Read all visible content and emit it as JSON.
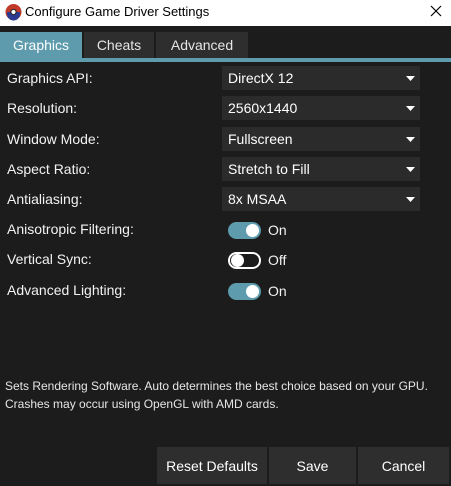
{
  "window": {
    "title": "Configure Game Driver Settings",
    "app_icon": "game-controller-icon",
    "close_icon": "close-icon"
  },
  "tabs": [
    {
      "label": "Graphics",
      "active": true
    },
    {
      "label": "Cheats",
      "active": false
    },
    {
      "label": "Advanced",
      "active": false
    }
  ],
  "settings": {
    "graphics_api": {
      "label": "Graphics API:",
      "value": "DirectX 12"
    },
    "resolution": {
      "label": "Resolution:",
      "value": "2560x1440"
    },
    "window_mode": {
      "label": "Window Mode:",
      "value": "Fullscreen"
    },
    "aspect_ratio": {
      "label": "Aspect Ratio:",
      "value": "Stretch to Fill"
    },
    "antialiasing": {
      "label": "Antialiasing:",
      "value": "8x MSAA"
    },
    "anisotropic_filtering": {
      "label": "Anisotropic Filtering:",
      "state": "On",
      "enabled": true
    },
    "vertical_sync": {
      "label": "Vertical Sync:",
      "state": "Off",
      "enabled": false
    },
    "advanced_lighting": {
      "label": "Advanced Lighting:",
      "state": "On",
      "enabled": true
    }
  },
  "description": {
    "line1": "Sets Rendering Software. Auto determines the best choice based on your GPU.",
    "line2": "Crashes may occur using OpenGL with AMD cards."
  },
  "buttons": {
    "reset": "Reset Defaults",
    "save": "Save",
    "cancel": "Cancel"
  },
  "colors": {
    "accent": "#5d9bad",
    "background": "#1c1c1c",
    "control": "#2b2b2b",
    "titlebar": "#ffffff"
  }
}
